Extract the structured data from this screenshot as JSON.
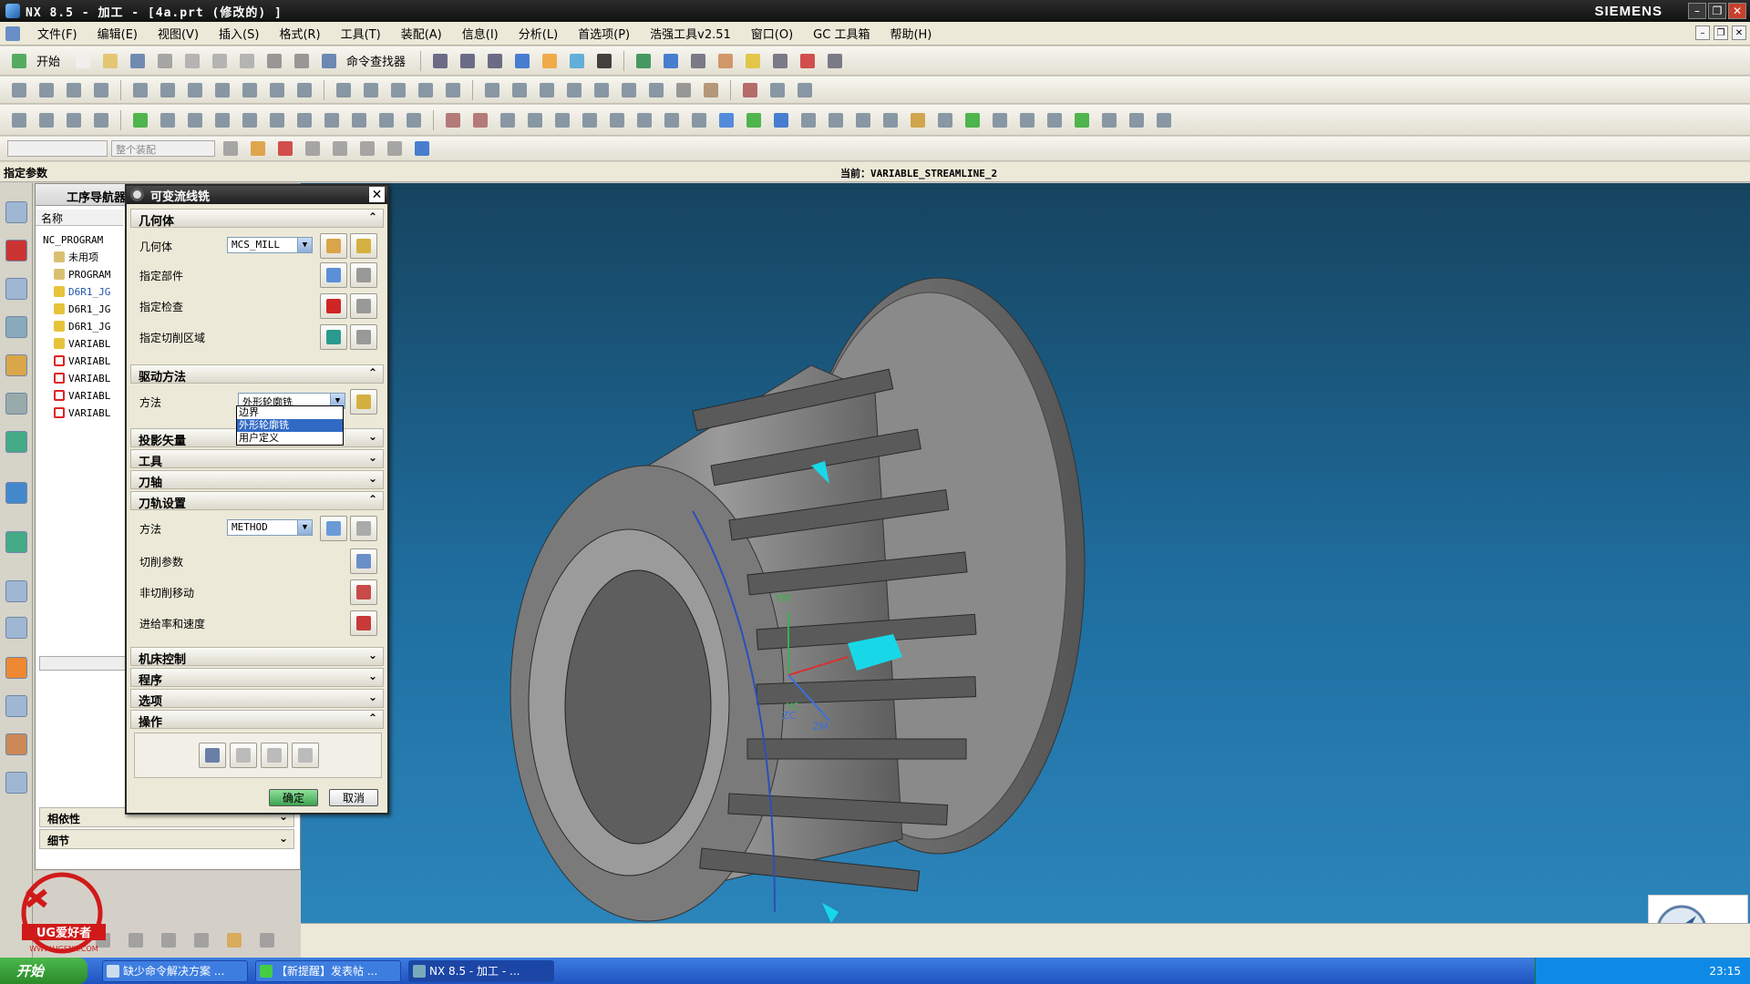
{
  "window": {
    "title": "NX 8.5 - 加工 - [4a.prt  (修改的) ]",
    "brand": "SIEMENS"
  },
  "menubar": [
    "文件(F)",
    "编辑(E)",
    "视图(V)",
    "插入(S)",
    "格式(R)",
    "工具(T)",
    "装配(A)",
    "信息(I)",
    "分析(L)",
    "首选项(P)",
    "浩强工具v2.51",
    "窗口(O)",
    "GC 工具箱",
    "帮助(H)"
  ],
  "toolbar": {
    "start_label": "开始",
    "command_finder_label": "命令查找器",
    "filter_placeholder": "整个装配"
  },
  "statusline": {
    "prompt": "指定参数",
    "current": "当前：VARIABLE_STREAMLINE_2"
  },
  "navigator": {
    "title": "工序导航器",
    "column_name": "名称",
    "items": [
      "NC_PROGRAM",
      "未用项",
      "PROGRAM",
      "D6R1_JG",
      "D6R1_JG",
      "D6R1_JG",
      "VARIABL",
      "VARIABL",
      "VARIABL",
      "VARIABL",
      "VARIABL"
    ],
    "bottom_sections": [
      "相依性",
      "细节"
    ]
  },
  "dialog": {
    "title": "可变流线铣",
    "sections": {
      "geometry": "几何体",
      "drive_method": "驱动方法",
      "projection_vector": "投影矢量",
      "tool": "工具",
      "tool_axis": "刀轴",
      "path_settings": "刀轨设置",
      "machine_control": "机床控制",
      "program": "程序",
      "options": "选项",
      "actions": "操作"
    },
    "geometry_label": "几何体",
    "geometry_value": "MCS_MILL",
    "specify_part": "指定部件",
    "specify_check": "指定检查",
    "specify_cut_area": "指定切削区域",
    "method_label": "方法",
    "method_value": "外形轮廓铣",
    "method_options": [
      "边界",
      "外形轮廓铣",
      "用户定义"
    ],
    "path_method_label": "方法",
    "path_method_value": "METHOD",
    "cut_params": "切削参数",
    "non_cut_moves": "非切削移动",
    "feeds_speeds": "进给率和速度",
    "ok": "确定",
    "cancel": "取消"
  },
  "viewport": {
    "axis_labels": [
      "YM",
      "XC",
      "YC",
      "ZC",
      "ZM"
    ]
  },
  "watermark": {
    "brand": "UG爱好者",
    "url": "WWW.UGSNX.COM"
  },
  "taskbar": {
    "start_label": "开始",
    "tasks": [
      "缺少命令解决方案 ...",
      "【新提醒】发表帖 ...",
      "NX 8.5 - 加工 - ..."
    ],
    "clock": "23:15"
  },
  "colors": {
    "viewport_top": "#16445f",
    "viewport_bottom": "#2b85bb",
    "part_body": "#8a8a8a",
    "highlight_cyan": "#18d8e8",
    "ok_green": "#3ea350"
  }
}
